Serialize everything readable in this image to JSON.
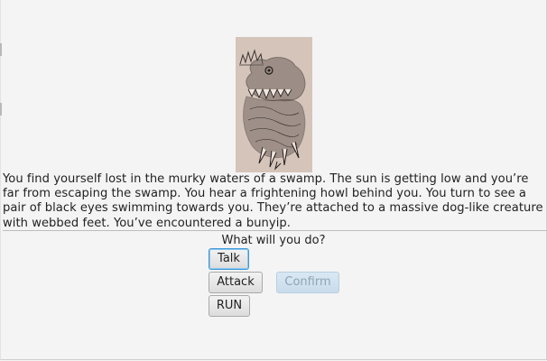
{
  "story": {
    "text": "You find yourself lost in the murky waters of a swamp. The sun is getting low and you’re far from escaping the swamp. You hear a frightening howl behind you. You turn to see a pair of black eyes swimming towards you. They’re attached to a massive dog-like creature with webbed feet. You’ve encountered a bunyip."
  },
  "illustration": {
    "subject": "bunyip-sketch"
  },
  "prompt": {
    "text": "What will you do?"
  },
  "actions": {
    "talk_label": "Talk",
    "attack_label": "Attack",
    "run_label": "RUN",
    "confirm_label": "Confirm"
  },
  "colors": {
    "focus_border": "#3a9ad9",
    "disabled_button": "#c9dceb",
    "background": "#f4f4f4"
  }
}
